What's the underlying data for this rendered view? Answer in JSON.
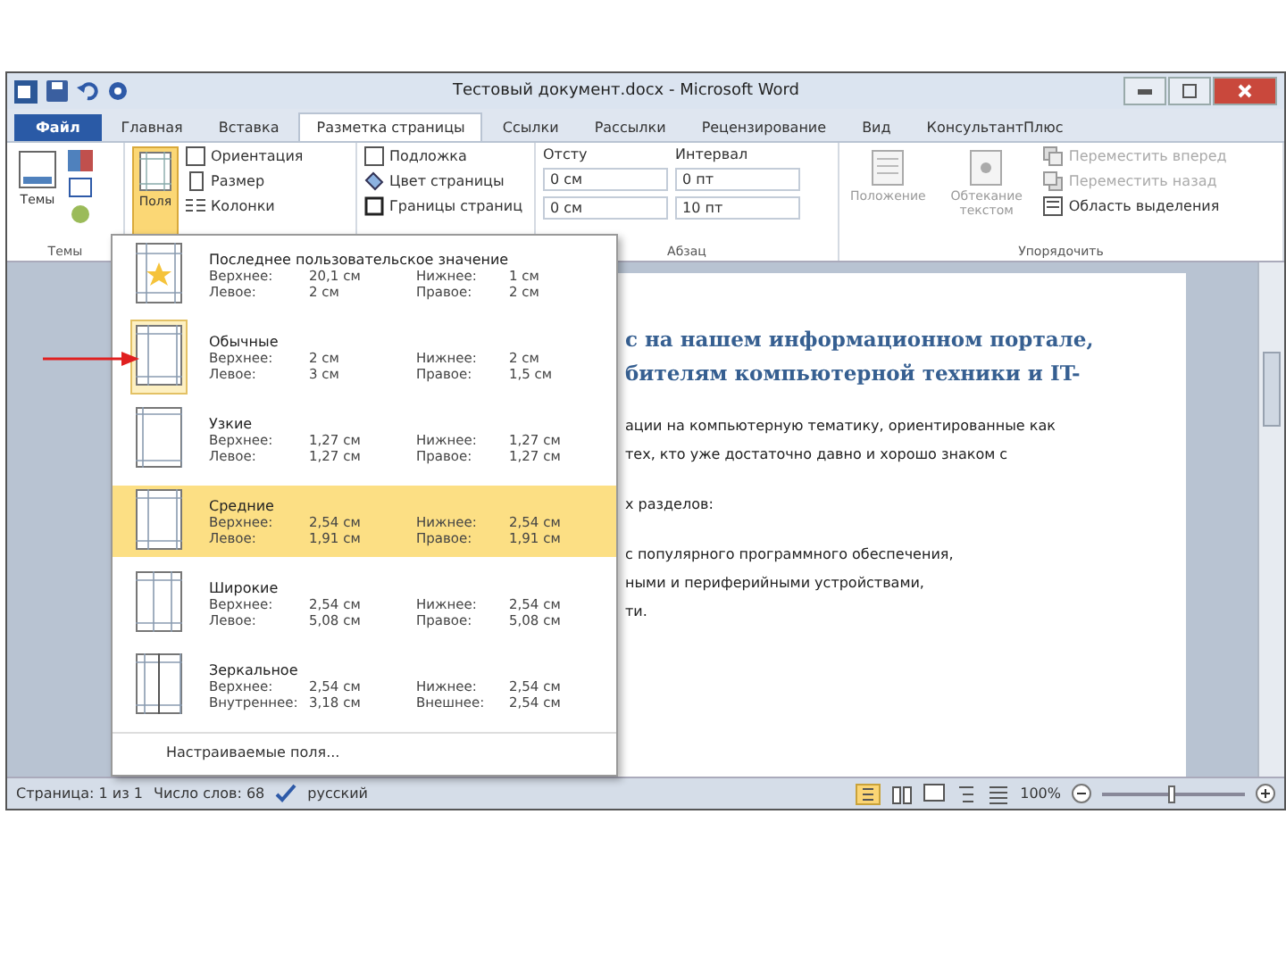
{
  "window": {
    "title": "Тестовый документ.docx - Microsoft Word"
  },
  "tabs": [
    {
      "label": "Файл",
      "kind": "file",
      "selected": false
    },
    {
      "label": "Главная",
      "kind": "tab",
      "selected": false
    },
    {
      "label": "Вставка",
      "kind": "tab",
      "selected": false
    },
    {
      "label": "Разметка страницы",
      "kind": "tab",
      "selected": true
    },
    {
      "label": "Ссылки",
      "kind": "tab",
      "selected": false
    },
    {
      "label": "Рассылки",
      "kind": "tab",
      "selected": false
    },
    {
      "label": "Рецензирование",
      "kind": "tab",
      "selected": false
    },
    {
      "label": "Вид",
      "kind": "tab",
      "selected": false
    },
    {
      "label": "КонсультантПлюс",
      "kind": "tab",
      "selected": false
    }
  ],
  "ribbon": {
    "themes": {
      "button": "Темы",
      "group_label": "Темы"
    },
    "page_setup": {
      "margins_button": {
        "label": "Поля",
        "expanded": true
      },
      "orientation": "Ориентация",
      "size": "Размер",
      "columns": "Колонки"
    },
    "page_background": {
      "watermark": "Подложка",
      "page_color": "Цвет страницы",
      "page_borders": "Границы страниц"
    },
    "paragraph": {
      "indent_label": "Отсту",
      "indent_left": "0 см",
      "indent_right": "0 см",
      "spacing_label": "Интервал",
      "spacing_before": "0 пт",
      "spacing_after": "10 пт",
      "group_label": "Абзац"
    },
    "arrange": {
      "position": "Положение",
      "wrap_text": "Обтекание текстом",
      "bring_forward": {
        "label": "Переместить вперед",
        "disabled": true
      },
      "send_backward": {
        "label": "Переместить назад",
        "disabled": true
      },
      "selection_pane": {
        "label": "Область выделения",
        "disabled": false
      },
      "group_label": "Упорядочить"
    }
  },
  "margins_menu": {
    "items": [
      {
        "name": "Последнее пользовательское значение",
        "kind": "custom",
        "current": false,
        "selected": false,
        "top_label": "Верхнее:",
        "top": "20,1 см",
        "bottom_label": "Нижнее:",
        "bottom": "1 см",
        "left_label": "Левое:",
        "left": "2 см",
        "right_label": "Правое:",
        "right": "2 см"
      },
      {
        "name": "Обычные",
        "kind": "normal",
        "current": true,
        "selected": false,
        "top_label": "Верхнее:",
        "top": "2 см",
        "bottom_label": "Нижнее:",
        "bottom": "2 см",
        "left_label": "Левое:",
        "left": "3 см",
        "right_label": "Правое:",
        "right": "1,5 см"
      },
      {
        "name": "Узкие",
        "kind": "narrow",
        "current": false,
        "selected": false,
        "top_label": "Верхнее:",
        "top": "1,27 см",
        "bottom_label": "Нижнее:",
        "bottom": "1,27 см",
        "left_label": "Левое:",
        "left": "1,27 см",
        "right_label": "Правое:",
        "right": "1,27 см"
      },
      {
        "name": "Средние",
        "kind": "normal",
        "current": false,
        "selected": true,
        "top_label": "Верхнее:",
        "top": "2,54 см",
        "bottom_label": "Нижнее:",
        "bottom": "2,54 см",
        "left_label": "Левое:",
        "left": "1,91 см",
        "right_label": "Правое:",
        "right": "1,91 см"
      },
      {
        "name": "Широкие",
        "kind": "wide",
        "current": false,
        "selected": false,
        "top_label": "Верхнее:",
        "top": "2,54 см",
        "bottom_label": "Нижнее:",
        "bottom": "2,54 см",
        "left_label": "Левое:",
        "left": "5,08 см",
        "right_label": "Правое:",
        "right": "5,08 см"
      },
      {
        "name": "Зеркальное",
        "kind": "mirror",
        "current": false,
        "selected": false,
        "top_label": "Верхнее:",
        "top": "2,54 см",
        "bottom_label": "Нижнее:",
        "bottom": "2,54 см",
        "left_label": "Внутреннее:",
        "left": "3,18 см",
        "right_label": "Внешнее:",
        "right": "2,54 см"
      }
    ],
    "custom": "Настраиваемые поля..."
  },
  "document": {
    "heading": [
      "с на нашем информационном портале,",
      "бителям компьютерной техники и IT-"
    ],
    "paragraphs": [
      [
        "ации на компьютерную тематику, ориентированные как",
        "тех, кто уже достаточно давно и хорошо знаком с"
      ],
      [
        "х разделов:"
      ],
      [
        "с популярного программного обеспечения,",
        "ными и периферийными устройствами,",
        "ти."
      ]
    ]
  },
  "status_bar": {
    "page": "Страница: 1 из 1",
    "words": "Число слов: 68",
    "language": "русский",
    "zoom": "100%",
    "zoom_slider": {
      "level": 0.5
    }
  }
}
